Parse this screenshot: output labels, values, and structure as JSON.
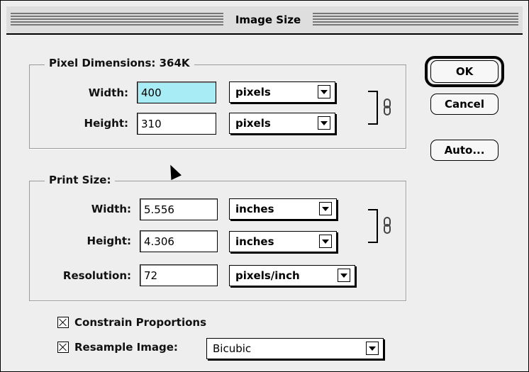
{
  "window": {
    "title": "Image Size"
  },
  "pixel_dimensions": {
    "title": "Pixel Dimensions: 364K",
    "width_label": "Width:",
    "width_value": "400",
    "width_unit": "pixels",
    "height_label": "Height:",
    "height_value": "310",
    "height_unit": "pixels"
  },
  "print_size": {
    "title": "Print Size:",
    "width_label": "Width:",
    "width_value": "5.556",
    "width_unit": "inches",
    "height_label": "Height:",
    "height_value": "4.306",
    "height_unit": "inches",
    "resolution_label": "Resolution:",
    "resolution_value": "72",
    "resolution_unit": "pixels/inch"
  },
  "buttons": {
    "ok": "OK",
    "cancel": "Cancel",
    "auto": "Auto..."
  },
  "options": {
    "constrain_label": "Constrain Proportions",
    "constrain_checked": true,
    "resample_label": "Resample Image:",
    "resample_checked": true,
    "resample_method": "Bicubic"
  },
  "colors": {
    "dialog_bg": "#eeeeee",
    "selected_field": "#a8ecf6"
  }
}
